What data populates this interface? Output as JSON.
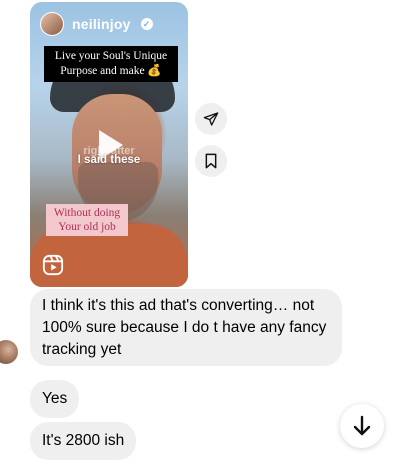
{
  "reel": {
    "username": "neilinjoy",
    "caption_line1": "Live your Soul's Unique",
    "caption_line2": "Purpose and make 💰",
    "overlay_faint": "right after",
    "overlay_text": "I said these",
    "pink_line1": "Without doing",
    "pink_line2": "Your old job"
  },
  "messages": [
    {
      "text": "I think it's this ad that's converting… not 100% sure because I do t have any fancy tracking yet"
    },
    {
      "text": "Yes"
    },
    {
      "text": "It's 2800 ish"
    }
  ],
  "icons": {
    "share": "paper-plane-icon",
    "save": "bookmark-icon",
    "scroll_down": "arrow-down-icon",
    "reels": "reels-icon",
    "play": "play-icon",
    "verified": "verified-badge-icon"
  },
  "colors": {
    "bubble_bg": "#efefef",
    "caption_bg": "#000000",
    "pink_box_bg": "#f3c8cd",
    "pink_box_text": "#b0305a"
  }
}
